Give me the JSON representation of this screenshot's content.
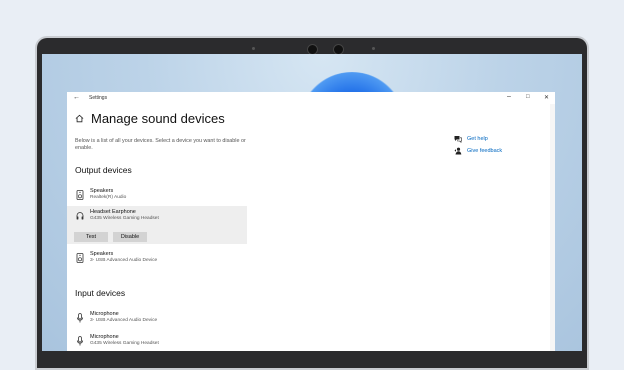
{
  "window": {
    "title": "Settings",
    "back_icon": "back-arrow-icon",
    "controls": {
      "minimize": "–",
      "maximize": "□",
      "close": "✕"
    }
  },
  "page": {
    "title": "Manage sound devices",
    "intro": "Below is a list of all your devices. Select a device you want to disable or enable."
  },
  "output": {
    "heading": "Output devices",
    "devices": [
      {
        "name": "Speakers",
        "sub": "Realtek(R) Audio",
        "icon": "speaker-icon"
      },
      {
        "name": "Headset Earphone",
        "sub": "G435 Wireless Gaming Headset",
        "icon": "headset-icon",
        "selected": true
      },
      {
        "name": "Speakers",
        "sub": "3- USB Advanced Audio Device",
        "icon": "speaker-icon"
      }
    ],
    "test_label": "Test",
    "disable_label": "Disable"
  },
  "input": {
    "heading": "Input devices",
    "devices": [
      {
        "name": "Microphone",
        "sub": "3- USB Advanced Audio Device",
        "icon": "microphone-icon"
      },
      {
        "name": "Microphone",
        "sub": "G435 Wireless Gaming Headset",
        "icon": "microphone-icon"
      }
    ]
  },
  "help": {
    "get_help": "Get help",
    "give_feedback": "Give feedback"
  },
  "colors": {
    "accent": "#0067c0",
    "selected_bg": "#eeeeee",
    "button_bg": "#d3d3d3"
  }
}
